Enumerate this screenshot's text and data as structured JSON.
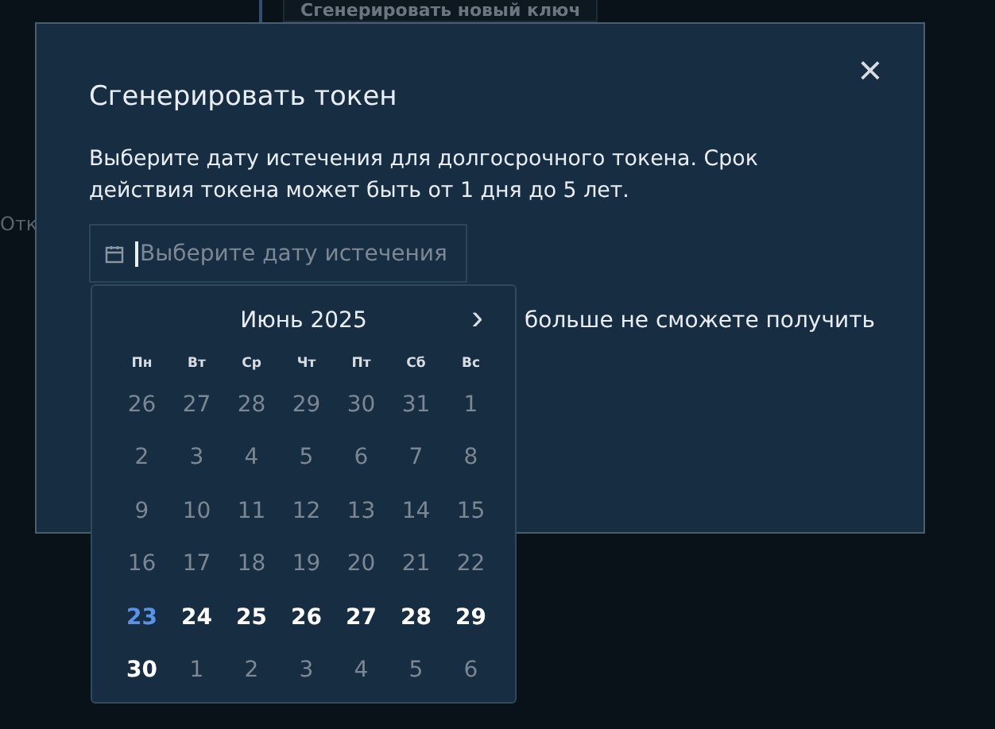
{
  "background": {
    "button": "Сгенерировать новый ключ",
    "side_text": "Отк"
  },
  "dialog": {
    "title": "Сгенерировать токен",
    "close": "×",
    "description": "Выберите дату истечения для долгосрочного токена. Срок действия токена может быть от 1 дня до 5 лет.",
    "date_field": {
      "placeholder": "Выберите дату истечения"
    },
    "note_fragment": "больше не сможете получить"
  },
  "calendar": {
    "month": "Июнь 2025",
    "next": "›",
    "weekdays": [
      "Пн",
      "Вт",
      "Ср",
      "Чт",
      "Пт",
      "Сб",
      "Вс"
    ],
    "days": [
      {
        "label": "26",
        "kind": "disabled"
      },
      {
        "label": "27",
        "kind": "disabled"
      },
      {
        "label": "28",
        "kind": "disabled"
      },
      {
        "label": "29",
        "kind": "disabled"
      },
      {
        "label": "30",
        "kind": "disabled"
      },
      {
        "label": "31",
        "kind": "disabled"
      },
      {
        "label": "1",
        "kind": "disabled"
      },
      {
        "label": "2",
        "kind": "disabled"
      },
      {
        "label": "3",
        "kind": "disabled"
      },
      {
        "label": "4",
        "kind": "disabled"
      },
      {
        "label": "5",
        "kind": "disabled"
      },
      {
        "label": "6",
        "kind": "disabled"
      },
      {
        "label": "7",
        "kind": "disabled"
      },
      {
        "label": "8",
        "kind": "disabled"
      },
      {
        "label": "9",
        "kind": "disabled"
      },
      {
        "label": "10",
        "kind": "disabled"
      },
      {
        "label": "11",
        "kind": "disabled"
      },
      {
        "label": "12",
        "kind": "disabled"
      },
      {
        "label": "13",
        "kind": "disabled"
      },
      {
        "label": "14",
        "kind": "disabled"
      },
      {
        "label": "15",
        "kind": "disabled"
      },
      {
        "label": "16",
        "kind": "disabled"
      },
      {
        "label": "17",
        "kind": "disabled"
      },
      {
        "label": "18",
        "kind": "disabled"
      },
      {
        "label": "19",
        "kind": "disabled"
      },
      {
        "label": "20",
        "kind": "disabled"
      },
      {
        "label": "21",
        "kind": "disabled"
      },
      {
        "label": "22",
        "kind": "disabled"
      },
      {
        "label": "23",
        "kind": "today"
      },
      {
        "label": "24",
        "kind": "available"
      },
      {
        "label": "25",
        "kind": "available"
      },
      {
        "label": "26",
        "kind": "available"
      },
      {
        "label": "27",
        "kind": "available"
      },
      {
        "label": "28",
        "kind": "available"
      },
      {
        "label": "29",
        "kind": "available"
      },
      {
        "label": "30",
        "kind": "available"
      },
      {
        "label": "1",
        "kind": "disabled"
      },
      {
        "label": "2",
        "kind": "disabled"
      },
      {
        "label": "3",
        "kind": "disabled"
      },
      {
        "label": "4",
        "kind": "disabled"
      },
      {
        "label": "5",
        "kind": "disabled"
      },
      {
        "label": "6",
        "kind": "disabled"
      }
    ]
  }
}
